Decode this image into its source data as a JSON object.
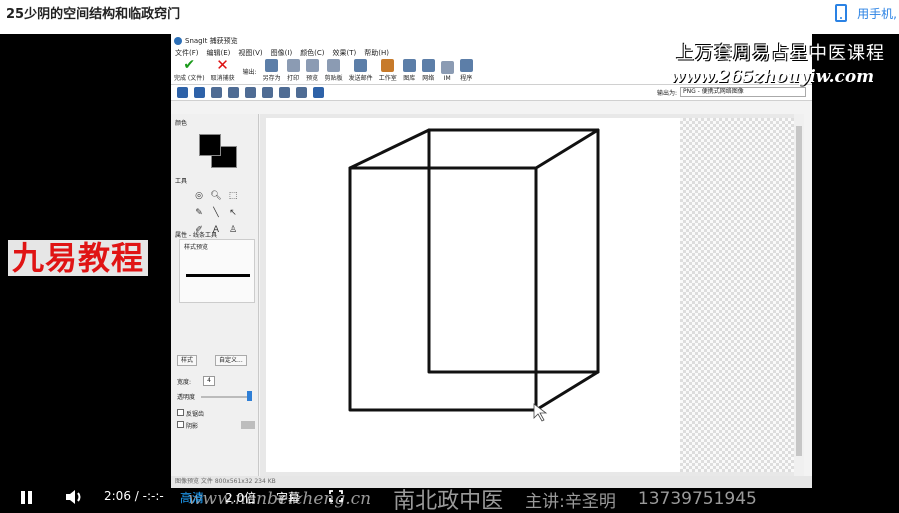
{
  "page": {
    "title": "25少阴的空间结构和临政窍门",
    "phone_link": "用手机,"
  },
  "snagit": {
    "window_title": "SnagIt 捕获预览",
    "menu": [
      "文件(F)",
      "编辑(E)",
      "视图(V)",
      "图像(I)",
      "颜色(C)",
      "效果(T)",
      "帮助(H)"
    ],
    "ribbon": {
      "done": "完成 (文件)",
      "cancel": "取消捕获",
      "output_label": "输出:",
      "buttons": [
        "另存为",
        "打印",
        "预览",
        "剪贴板",
        "发送邮件",
        "工作室",
        "图库",
        "网络",
        "IM",
        "程序"
      ]
    },
    "output_format_label": "输出为:",
    "output_format_value": "PNG - 便携式网络图像",
    "sidebar": {
      "color_label": "颜色",
      "tools_label": "工具",
      "props_label": "属性 - 线条工具",
      "style_preview_label": "样式预览",
      "style_button": "样式",
      "custom_button": "自定义...",
      "width_label": "宽度:",
      "width_value": "4",
      "opacity_label": "透明度",
      "antialias_label": "反锯齿",
      "shadow_label": "阴影"
    },
    "status": "图像预览 文件      800x561x32         234 KB"
  },
  "overlays": {
    "brand_top": "上万套周易占星中医课程",
    "brand_url": "www.265zhouyiw.com",
    "jiuyi": "九易教程",
    "watermark_url": "www.nanbeizheng.cn",
    "watermark_school": "南北政中医",
    "watermark_lecturer": "主讲:辛圣明",
    "watermark_phone": "13739751945"
  },
  "player": {
    "time": "2:06 / -:-:-",
    "quality": "高清",
    "speed": "2.0倍",
    "subtitles": "字幕"
  },
  "colors": {
    "accent": "#1fa3ff",
    "brand_red": "#e01414"
  }
}
